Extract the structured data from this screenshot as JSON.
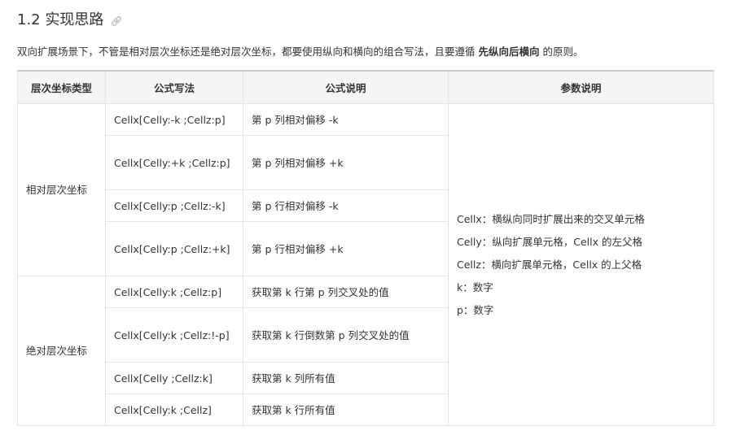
{
  "title": "1.2 实现思路",
  "intro": {
    "before": "双向扩展场景下，不管是相对层次坐标还是绝对层次坐标，都要使用纵向和横向的组合写法，且要遵循 ",
    "bold": "先纵向后横向",
    "after": " 的原则。"
  },
  "headers": [
    "层次坐标类型",
    "公式写法",
    "公式说明",
    "参数说明"
  ],
  "groups": [
    "相对层次坐标",
    "绝对层次坐标"
  ],
  "rows": [
    {
      "formula": "Cellx[Celly:-k ;Cellz:p]",
      "desc": "第 p 列相对偏移 -k"
    },
    {
      "formula": "Cellx[Celly:+k ;Cellz:p]",
      "desc": "第 p 列相对偏移 +k"
    },
    {
      "formula": "Cellx[Celly:p ;Cellz:-k]",
      "desc": "第 p 行相对偏移 -k"
    },
    {
      "formula": "Cellx[Celly:p ;Cellz:+k]",
      "desc": "第 p 行相对偏移 +k"
    },
    {
      "formula": "Cellx[Celly:k ;Cellz:p]",
      "desc": "获取第 k 行第 p 列交叉处的值"
    },
    {
      "formula": "Cellx[Celly:k ;Cellz:!-p]",
      "desc": "获取第 k 行倒数第 p 列交叉处的值"
    },
    {
      "formula": "Cellx[Celly ;Cellz:k]",
      "desc": "获取第 k 列所有值"
    },
    {
      "formula": "Cellx[Celly:k ;Cellz]",
      "desc": "获取第 k 行所有值"
    }
  ],
  "params": [
    "Cellx：横纵向同时扩展出来的交叉单元格",
    "Celly：纵向扩展单元格，Cellx 的左父格",
    "Cellz：横向扩展单元格，Cellx 的上父格",
    "k：数字",
    "p：数字"
  ]
}
